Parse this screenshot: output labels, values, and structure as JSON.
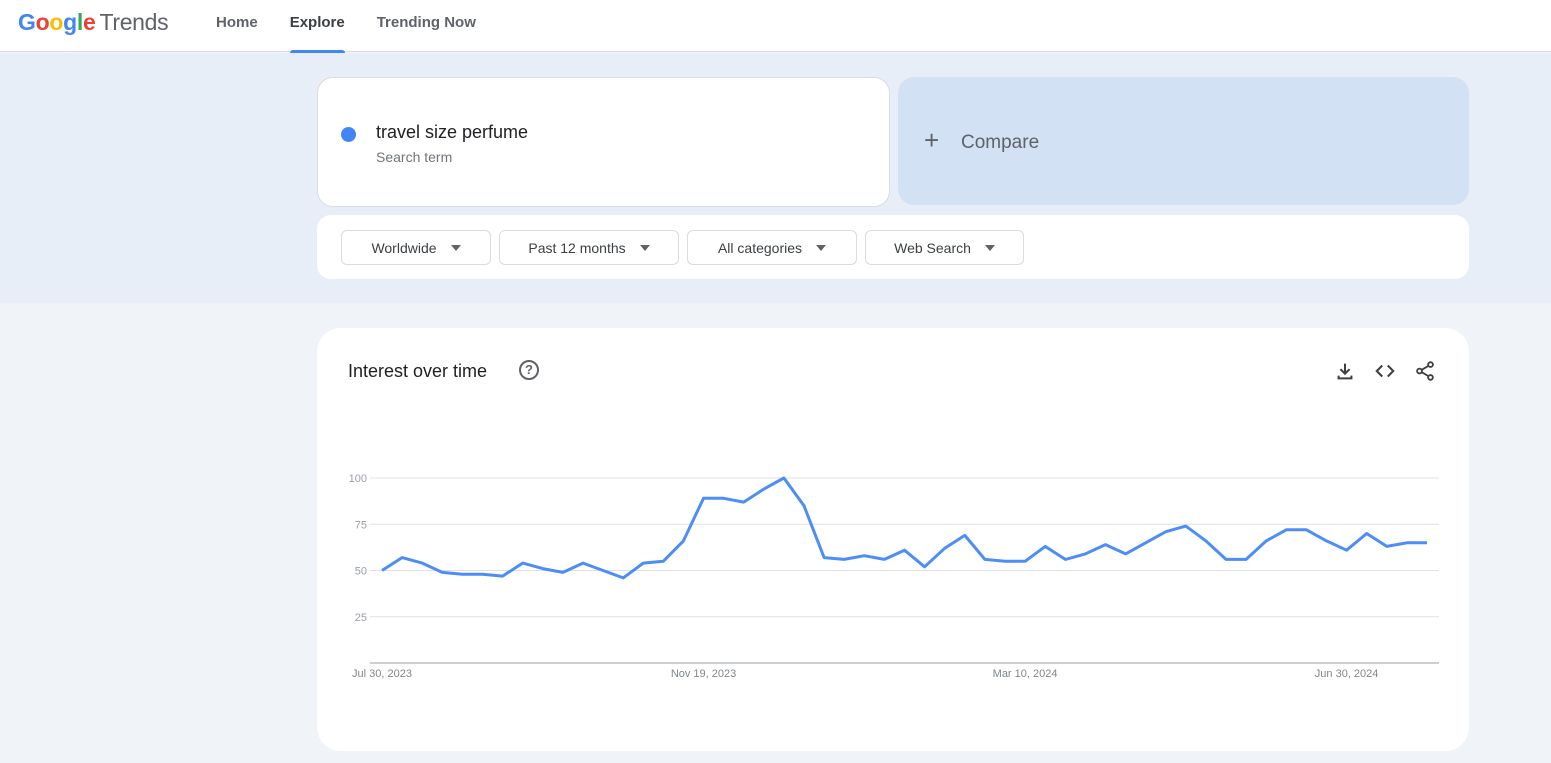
{
  "header": {
    "logo_google": "Google",
    "logo_trends": "Trends",
    "nav": [
      {
        "label": "Home",
        "active": false
      },
      {
        "label": "Explore",
        "active": true
      },
      {
        "label": "Trending Now",
        "active": false
      }
    ]
  },
  "search_term": {
    "name": "travel size perfume",
    "subtitle": "Search term",
    "color": "#4285f4"
  },
  "compare": {
    "icon": "plus-icon",
    "label": "Compare"
  },
  "filters": [
    {
      "label": "Worldwide"
    },
    {
      "label": "Past 12 months"
    },
    {
      "label": "All categories"
    },
    {
      "label": "Web Search"
    }
  ],
  "interest_card": {
    "title": "Interest over time",
    "help_icon": "?",
    "actions": [
      "download-icon",
      "embed-code-icon",
      "share-icon"
    ]
  },
  "chart_data": {
    "type": "line",
    "title": "Interest over time",
    "xlabel": "",
    "ylabel": "",
    "ylim": [
      0,
      100
    ],
    "yticks": [
      25,
      50,
      75,
      100
    ],
    "grid": true,
    "x_tick_labels": [
      {
        "index": 0,
        "label": "Jul 30, 2023"
      },
      {
        "index": 16,
        "label": "Nov 19, 2023"
      },
      {
        "index": 32,
        "label": "Mar 10, 2024"
      },
      {
        "index": 48,
        "label": "Jun 30, 2024"
      }
    ],
    "series": [
      {
        "name": "travel size perfume",
        "color": "#4c8df6",
        "values": [
          50,
          57,
          54,
          49,
          48,
          48,
          47,
          54,
          51,
          49,
          54,
          50,
          46,
          54,
          55,
          66,
          89,
          89,
          87,
          94,
          100,
          85,
          57,
          56,
          58,
          56,
          61,
          52,
          62,
          69,
          56,
          55,
          55,
          63,
          56,
          59,
          64,
          59,
          65,
          71,
          74,
          66,
          56,
          56,
          66,
          72,
          72,
          66,
          61,
          70,
          63,
          65,
          65
        ]
      }
    ]
  }
}
